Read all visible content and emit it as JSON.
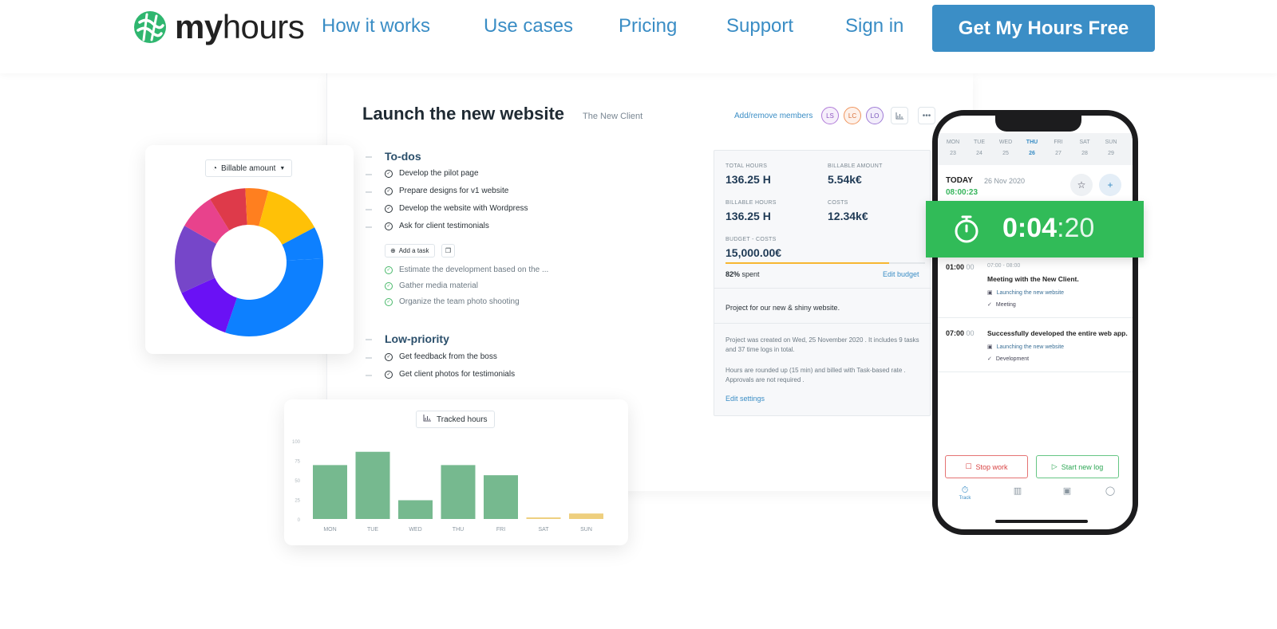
{
  "nav": {
    "logo_bold": "my",
    "logo_light": "hours",
    "links": [
      "How it works",
      "Use cases",
      "Pricing",
      "Support",
      "Sign in"
    ],
    "cta": "Get My Hours Free"
  },
  "project": {
    "title": "Launch the new website",
    "client": "The New Client",
    "members_link": "Add/remove members",
    "members": [
      "LS",
      "LC",
      "LO"
    ],
    "more": "•••",
    "todos_heading": "To-dos",
    "todos": [
      "Develop the pilot page",
      "Prepare designs for v1 website",
      "Develop the website with Wordpress",
      "Ask for client testimonials"
    ],
    "add_task": "Add a task",
    "done": [
      "Estimate the development based on the ...",
      "Gather media material",
      "Organize the team photo shooting"
    ],
    "low_heading": "Low-priority",
    "low": [
      "Get feedback from the boss",
      "Get client photos for testimonials"
    ]
  },
  "stats": {
    "total_hours_label": "TOTAL HOURS",
    "total_hours": "136.25 H",
    "billable_amount_label": "BILLABLE AMOUNT",
    "billable_amount": "5.54k€",
    "billable_hours_label": "BILLABLE HOURS",
    "billable_hours": "136.25 H",
    "costs_label": "COSTS",
    "costs": "12.34k€",
    "budget_label": "BUDGET - COSTS",
    "budget": "15,000.00€",
    "spent_pct": "82%",
    "spent_word": "spent",
    "spent_fraction": 0.82,
    "edit_budget": "Edit budget",
    "description": "Project for our new & shiny website.",
    "info1": "Project was created on Wed, 25 November 2020 . It includes 9 tasks and 37 time logs in total.",
    "info2": "Hours are rounded up (15 min) and billed with Task-based rate . Approvals are not required .",
    "edit_settings": "Edit settings"
  },
  "donut": {
    "selector": "Billable amount",
    "chart_data": {
      "type": "pie",
      "values": [
        31,
        13,
        15,
        8,
        8,
        5,
        13,
        7
      ],
      "colors": [
        "#0d80ff",
        "#6a11f5",
        "#7646c9",
        "#e8428c",
        "#de3a4a",
        "#ff7f1f",
        "#ffc107",
        "#0d80ff"
      ]
    }
  },
  "bars": {
    "selector": "Tracked hours",
    "chart_data": {
      "type": "bar",
      "categories": [
        "MON",
        "TUE",
        "WED",
        "THU",
        "FRI",
        "SAT",
        "SUN"
      ],
      "values": [
        69,
        86,
        24,
        69,
        56,
        2,
        7
      ],
      "ylim": [
        0,
        100
      ],
      "yticks": [
        "100",
        "75",
        "50",
        "25",
        "0"
      ],
      "colors": [
        "#76b98f",
        "#76b98f",
        "#76b98f",
        "#76b98f",
        "#76b98f",
        "#eecf7e",
        "#eecf7e"
      ]
    }
  },
  "phone": {
    "days": [
      "MON",
      "TUE",
      "WED",
      "THU",
      "FRI",
      "SAT",
      "SUN"
    ],
    "dates": [
      "23",
      "24",
      "25",
      "26",
      "27",
      "28",
      "29"
    ],
    "today": "TODAY",
    "today_date": "26 Nov 2020",
    "today_time": "08:00:23",
    "entry1_time": "01:00",
    "entry1_min": "00",
    "entry1_range": "07:00 - 08:00",
    "entry1_desc": "Meeting with the New Client.",
    "entry1_project": "Launching the new website",
    "entry1_task": "Meeting",
    "entry2_time": "07:00",
    "entry2_min": "00",
    "entry2_desc": "Successfully developed the entire web app.",
    "entry2_project": "Launching the new website",
    "entry2_task": "Development",
    "stop": "Stop work",
    "start": "Start new log",
    "tab_track": "Track"
  },
  "timer": {
    "hm": "0:04",
    "sec": ":20"
  }
}
